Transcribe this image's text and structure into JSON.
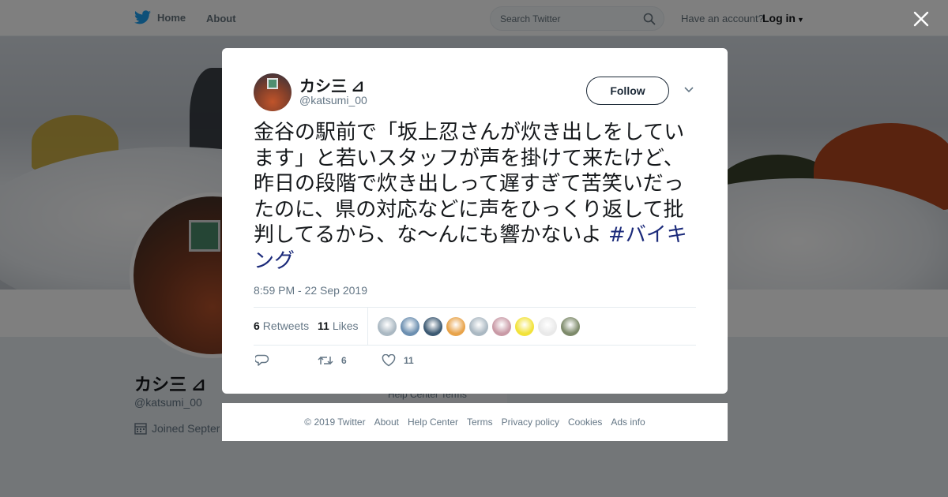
{
  "topbar": {
    "home_label": "Home",
    "about_label": "About",
    "search_placeholder": "Search Twitter",
    "account_prompt": "Have an account?",
    "login_label": "Log in"
  },
  "profile": {
    "name": "カシ三 ⊿",
    "handle": "@katsumi_00",
    "joined": "Joined Septer",
    "help_text": "Help Center   Terms"
  },
  "tweet": {
    "name": "カシ三 ⊿",
    "handle": "@katsumi_00",
    "follow_label": "Follow",
    "text": "金谷の駅前で「坂上忍さんが炊き出しをしています」と若いスタッフが声を掛けて来たけど、昨日の段階で炊き出しって遅すぎて苦笑いだったのに、県の対応などに声をひっくり返して批判してるから、な〜んにも響かないよ ",
    "hashtag": "#バイキング",
    "timestamp": "8:59 PM - 22 Sep 2019",
    "retweets_count": "6",
    "retweets_label": "Retweets",
    "likes_count": "11",
    "likes_label": "Likes",
    "reply_count": "",
    "retweet_action_count": "6",
    "like_action_count": "11"
  },
  "likers": [
    {
      "icon": "default-avatar",
      "color": "#aab8c2"
    },
    {
      "icon": "landscape-avatar",
      "color": "#6c8fb0"
    },
    {
      "icon": "cyclist-avatar",
      "color": "#3d5a73"
    },
    {
      "icon": "cat-avatar",
      "color": "#e8a34a"
    },
    {
      "icon": "default-avatar",
      "color": "#aab8c2"
    },
    {
      "icon": "pink-avatar",
      "color": "#c99aa6"
    },
    {
      "icon": "chick-avatar",
      "color": "#f2e23a"
    },
    {
      "icon": "dog-avatar",
      "color": "#e9e9e9"
    },
    {
      "icon": "photo-avatar",
      "color": "#7d8a6a"
    }
  ],
  "footer": {
    "links": [
      "© 2019 Twitter",
      "About",
      "Help Center",
      "Terms",
      "Privacy policy",
      "Cookies",
      "Ads info"
    ]
  },
  "colors": {
    "twitter_blue": "#1da1f2",
    "hashtag": "#1b2a7a",
    "follow_border": "#1b2836"
  }
}
